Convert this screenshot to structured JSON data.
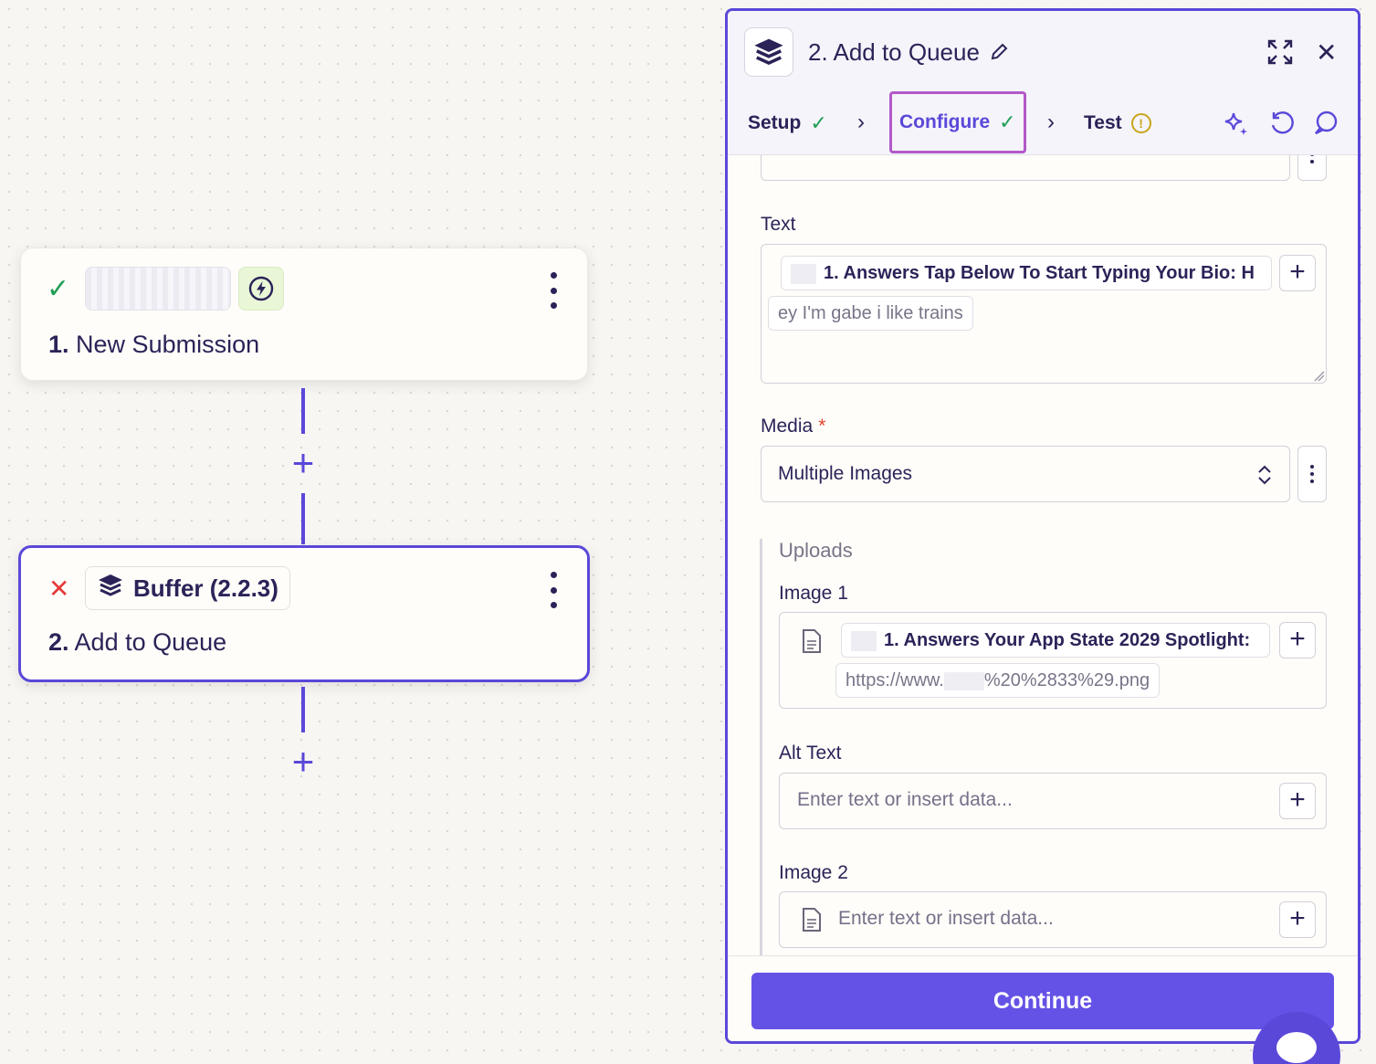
{
  "canvas": {
    "step1": {
      "number": "1.",
      "title": "New Submission",
      "status": "success",
      "trigger_chip": "lightning-icon"
    },
    "step2": {
      "number": "2.",
      "title": "Add to Queue",
      "status": "error",
      "app_label": "Buffer (2.2.3)"
    },
    "add_step_symbol": "+"
  },
  "panel": {
    "title": "2. Add to Queue",
    "tabs": [
      {
        "label": "Setup",
        "state": "complete"
      },
      {
        "label": "Configure",
        "state": "active-complete"
      },
      {
        "label": "Test",
        "state": "warning"
      }
    ],
    "fields": {
      "text": {
        "label": "Text",
        "token_line1": "1. Answers Tap Below To Start Typing Your Bio: H",
        "token_line2": "ey I'm gabe i like trains"
      },
      "media": {
        "label": "Media",
        "required_marker": "*",
        "value": "Multiple Images"
      },
      "uploads": {
        "group_label": "Uploads",
        "image1": {
          "label": "Image 1",
          "token_line1": "1. Answers Your App State 2029 Spotlight:",
          "url_prefix": "https://www.",
          "url_suffix": "%20%2833%29.png"
        },
        "alt_text": {
          "label": "Alt Text",
          "placeholder": "Enter text or insert data..."
        },
        "image2": {
          "label": "Image 2",
          "placeholder": "Enter text or insert data..."
        }
      }
    },
    "continue_label": "Continue"
  },
  "colors": {
    "accent": "#5a48d9",
    "button": "#6452e6",
    "success": "#1f9d55",
    "error": "#e53b3b",
    "warning": "#c9a418"
  }
}
